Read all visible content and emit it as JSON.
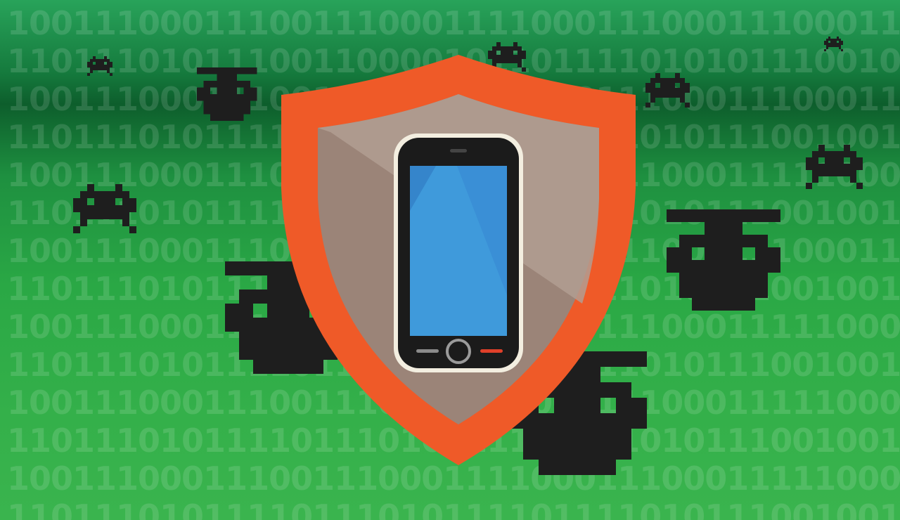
{
  "binary_rows": [
    "1001110001110011100011110001110001110001110001",
    "1101110101110011000010110111101010111001001101",
    "1001110001110011100011110001110001110001110001",
    "1101110101111001100011110111101011100100110111",
    "1001110001110011100011110001110001111100011001",
    "1101110101111011100011110111101011100100110111",
    "1001110001110011100011110001110001110001110001",
    "1101110101111011100011110111101011100100110111",
    "1001110001110011100011110001110001111100011001",
    "1101110101111011101011110111101011100100110111",
    "1001110001110011100011110001110001111100011001",
    "1101110101111011101011110111101011100100110111",
    "1001110001110011100011110001110001111100011001",
    "1101110101111011101011110111101011100100110111"
  ],
  "colors": {
    "shield_outer": "#ef5a28",
    "shield_inner": "#9b8478",
    "bug": "#1e1e1e",
    "screen": "#3a8fd6"
  }
}
